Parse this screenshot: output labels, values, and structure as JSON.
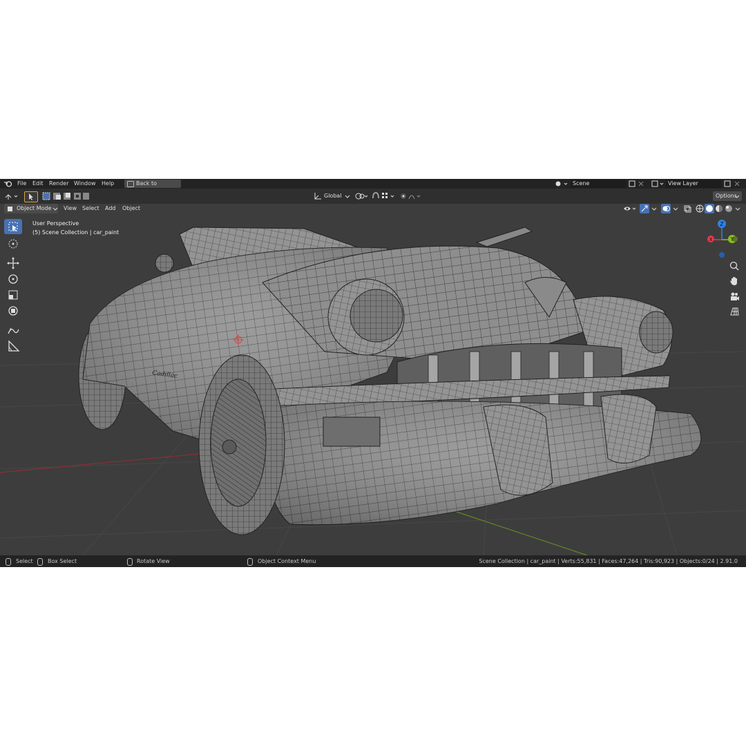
{
  "menubar": {
    "items": [
      "File",
      "Edit",
      "Render",
      "Window",
      "Help"
    ],
    "back_button": "Back to Previous",
    "scene": "Scene",
    "view_layer": "View Layer"
  },
  "toolheader": {
    "transform_orientation": "Global",
    "options_label": "Options"
  },
  "viewport_header": {
    "mode": "Object Mode",
    "menus": [
      "View",
      "Select",
      "Add",
      "Object"
    ]
  },
  "viewport": {
    "perspective_label": "User Perspective",
    "collection_label": "(5) Scene Collection | car_paint",
    "model_badge_text": "Cadillac"
  },
  "gizmo": {
    "z_label": "Z",
    "y_label": "Y",
    "x_label": "X"
  },
  "statusbar": {
    "select": "Select",
    "box_select": "Box Select",
    "rotate_view": "Rotate View",
    "context_menu": "Object Context Menu",
    "stats": "Scene Collection | car_paint | Verts:55,831 | Faces:47,264 | Tris:90,923 | Objects:0/24 | 2.91.0"
  },
  "colors": {
    "accent_blue": "#4772b3",
    "axis_x": "#e6394a",
    "axis_y": "#8ac01f",
    "axis_z": "#2f83e6",
    "mesh_fill": "#8e8e8e",
    "wire": "#1c1c1c"
  },
  "icons": [
    "blender-logo",
    "back-icon",
    "select-tool-icon",
    "cursor-icon",
    "move-icon",
    "rotate-icon",
    "scale-icon",
    "transform-icon",
    "annotate-icon",
    "measure-icon",
    "zoom-icon",
    "hand-icon",
    "camera-icon",
    "grid-icon",
    "snap-icon",
    "proportional-icon",
    "overlay-icon",
    "xray-icon",
    "shading-wire-icon",
    "shading-solid-icon",
    "shading-material-icon",
    "shading-render-icon",
    "mouse-left-icon",
    "mouse-middle-icon",
    "mouse-right-icon"
  ]
}
